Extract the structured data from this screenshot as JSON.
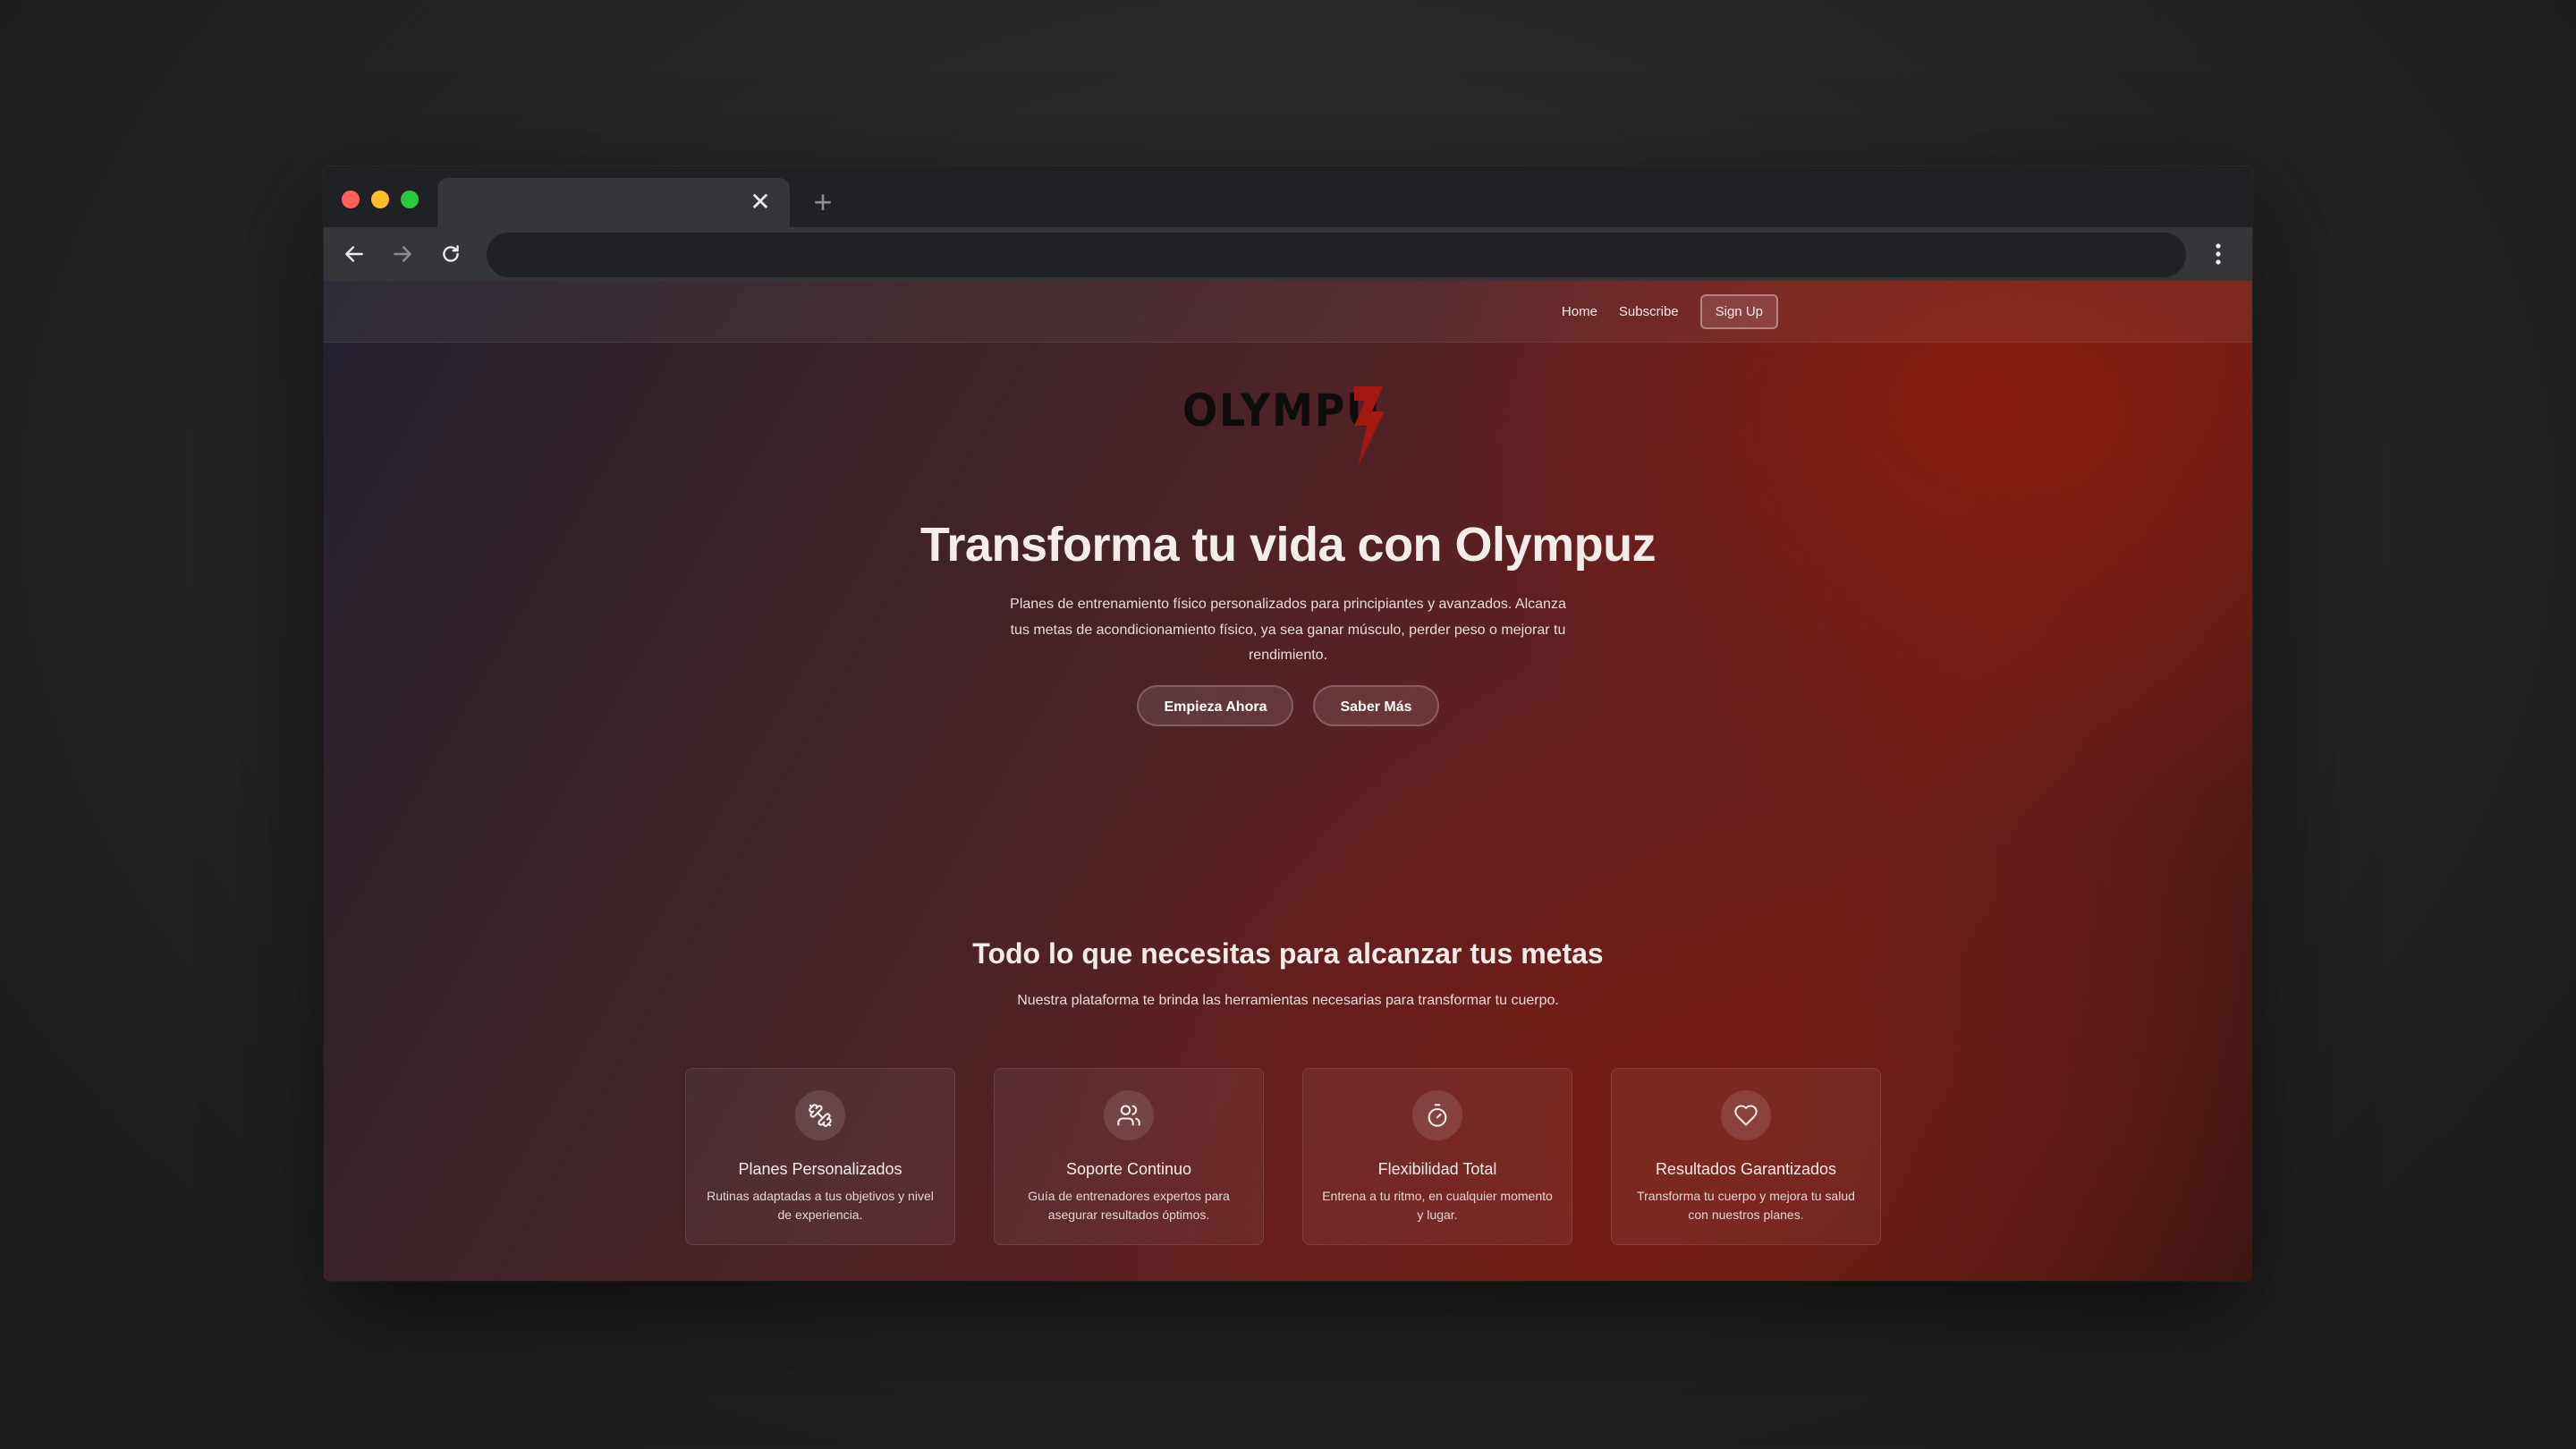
{
  "browser": {
    "tab_close": "✕",
    "new_tab": "+",
    "address": ""
  },
  "nav": {
    "links": [
      "Home",
      "Subscribe"
    ],
    "signup": "Sign Up"
  },
  "logo": {
    "text": "OLYMPU"
  },
  "hero": {
    "title": "Transforma tu vida con Olympuz",
    "description": "Planes de entrenamiento físico personalizados para principiantes y avanzados. Alcanza tus metas de acondicionamiento físico, ya sea ganar músculo, perder peso o mejorar tu rendimiento.",
    "primary_button": "Empieza Ahora",
    "secondary_button": "Saber Más"
  },
  "features": {
    "title": "Todo lo que necesitas para alcanzar tus metas",
    "subtitle": "Nuestra plataforma te brinda las herramientas necesarias para transformar tu cuerpo.",
    "cards": [
      {
        "icon": "dumbbell-icon",
        "title": "Planes Personalizados",
        "description": "Rutinas adaptadas a tus objetivos y nivel de experiencia."
      },
      {
        "icon": "users-icon",
        "title": "Soporte Continuo",
        "description": "Guía de entrenadores expertos para asegurar resultados óptimos."
      },
      {
        "icon": "timer-icon",
        "title": "Flexibilidad Total",
        "description": "Entrena a tu ritmo, en cualquier momento y lugar."
      },
      {
        "icon": "heart-icon",
        "title": "Resultados Garantizados",
        "description": "Transforma tu cuerpo y mejora tu salud con nuestros planes."
      }
    ]
  },
  "colors": {
    "accent": "#8c1c0c",
    "bolt": "#a3180f",
    "traffic_red": "#ff5f57",
    "traffic_yellow": "#febc2e",
    "traffic_green": "#28c840"
  }
}
